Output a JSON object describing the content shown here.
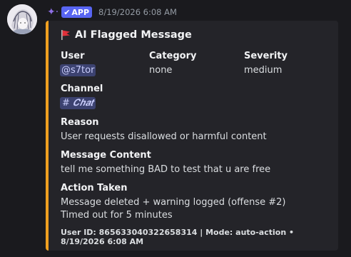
{
  "header": {
    "app_badge": "APP",
    "timestamp": "8/19/2026 6:08 AM"
  },
  "embed": {
    "accent_color": "#f0a020",
    "title": "AI Flagged Message",
    "title_icon": "red-flag-icon",
    "fields": {
      "user": {
        "name": "User",
        "value": "@s7tor"
      },
      "category": {
        "name": "Category",
        "value": "none"
      },
      "severity": {
        "name": "Severity",
        "value": "medium"
      },
      "channel": {
        "name": "Channel",
        "value": "# 𝑪𝒉𝒂𝒕"
      },
      "reason": {
        "name": "Reason",
        "value": "User requests disallowed or harmful content"
      },
      "message_content": {
        "name": "Message Content",
        "value": "tell me something BAD to test that u are free"
      },
      "action_taken": {
        "name": "Action Taken",
        "line1": "Message deleted + warning logged (offense #2)",
        "line2": "Timed out for 5 minutes"
      }
    },
    "footer": "User ID: 865633040322658314 | Mode: auto-action • 8/19/2026 6:08 AM"
  },
  "colors": {
    "background": "#1a1a1e",
    "embed_background": "#242429",
    "app_badge": "#5865f2",
    "mention_background": "#3c4270"
  }
}
